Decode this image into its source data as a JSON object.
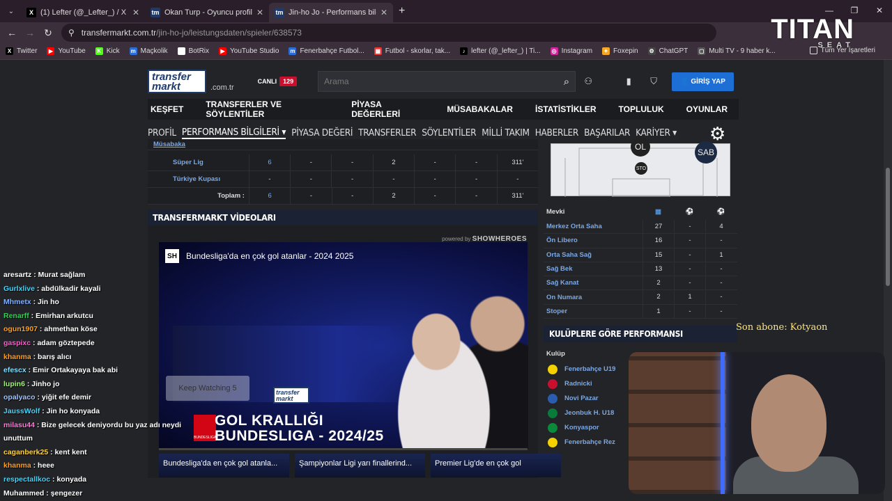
{
  "browser": {
    "tabs": [
      {
        "label": "(1) Lefter (@_Lefter_) / X",
        "icon": "X",
        "color": "#000"
      },
      {
        "label": "Okan Turp - Oyuncu profili | Tra",
        "icon": "tm",
        "color": "#1d3a6b"
      },
      {
        "label": "Jin-ho Jo - Performans bilgileri",
        "icon": "tm",
        "color": "#1d3a6b"
      }
    ],
    "url_host": "transfermarkt.com.tr",
    "url_path": "/jin-ho-jo/leistungsdaten/spieler/638573",
    "bookmarks": [
      {
        "label": "Twitter",
        "icon": "X",
        "color": "#000"
      },
      {
        "label": "YouTube",
        "icon": "▶",
        "color": "#f00"
      },
      {
        "label": "Kick",
        "icon": "K",
        "color": "#53fc18"
      },
      {
        "label": "Maçkolik",
        "icon": "m",
        "color": "#2b6cd6"
      },
      {
        "label": "BotRix",
        "icon": "◆",
        "color": "#fff"
      },
      {
        "label": "YouTube Studio",
        "icon": "▶",
        "color": "#f00"
      },
      {
        "label": "Fenerbahçe Futbol...",
        "icon": "m",
        "color": "#2b6cd6"
      },
      {
        "label": "Futbol - skorlar, tak...",
        "icon": "▦",
        "color": "#e33"
      },
      {
        "label": "lefter (@_lefter_) | Ti...",
        "icon": "♪",
        "color": "#000"
      },
      {
        "label": "Instagram",
        "icon": "◎",
        "color": "#d6249f"
      },
      {
        "label": "Foxepin",
        "icon": "✦",
        "color": "#f5a623"
      },
      {
        "label": "ChatGPT",
        "icon": "⚙",
        "color": "#444"
      },
      {
        "label": "Multi TV - 9 haber k...",
        "icon": "▢",
        "color": "#555"
      }
    ],
    "all_bookmarks": "Tüm Yer İşaretleri"
  },
  "overlay": {
    "brand": "TITAN",
    "brand_sub": "SEAT",
    "sub_alert": "Son abone: Kotyaon"
  },
  "site": {
    "logo_top": "transfer",
    "logo_bottom": "markt",
    "domain": ".com.tr",
    "live_label": "CANLI",
    "live_count": "129",
    "search_placeholder": "Arama",
    "login": "GİRİŞ YAP",
    "main_nav": [
      "KEŞFET",
      "TRANSFERLER VE SÖYLENTİLER",
      "PİYASA DEĞERLERİ",
      "MÜSABAKALAR",
      "İSTATİSTİKLER",
      "TOPLULUK",
      "OYUNLAR"
    ],
    "sub_nav": [
      "PROFİL",
      "PERFORMANS BİLGİLERİ ▾",
      "PİYASA DEĞERİ",
      "TRANSFERLER",
      "SÖYLENTİLER",
      "MİLLİ TAKIM",
      "HABERLER",
      "BAŞARILAR",
      "KARİYER ▾"
    ]
  },
  "stats": {
    "header": "Müsabaka",
    "rows": [
      {
        "name": "Süper Lig",
        "cells": [
          "6",
          "-",
          "-",
          "2",
          "-",
          "-",
          "311'"
        ]
      },
      {
        "name": "Türkiye Kupası",
        "cells": [
          "-",
          "-",
          "-",
          "-",
          "-",
          "-",
          "-"
        ]
      },
      {
        "name": "Toplam :",
        "cells": [
          "6",
          "-",
          "-",
          "2",
          "-",
          "-",
          "311'"
        ]
      }
    ]
  },
  "videos": {
    "title": "TRANSFERMARKT VİDEOLARI",
    "powered": "powered by",
    "powered_brand": "SHOWHEROES",
    "player_title": "Bundesliga'da en çok gol atanlar - 2024 2025",
    "banner_line1": "GOL KRALLIĞI",
    "banner_line2": "BUNDESLIGA - 2024/25",
    "banner_small": "BUNDESLIGA",
    "keep": "Keep Watching 5",
    "thumbs": [
      "Bundesliga'da en çok gol atanla...",
      "Şampiyonlar Ligi yarı finallerind...",
      "Premier Lig'de en çok gol"
    ]
  },
  "positions_pitch": [
    "OL",
    "SAB",
    "STO"
  ],
  "positions": {
    "header": "Mevki",
    "rows": [
      {
        "name": "Merkez Orta Saha",
        "v": [
          "27",
          "-",
          "4"
        ]
      },
      {
        "name": "Ön Libero",
        "v": [
          "16",
          "-",
          "-"
        ]
      },
      {
        "name": "Orta Saha Sağ",
        "v": [
          "15",
          "-",
          "1"
        ]
      },
      {
        "name": "Sağ Bek",
        "v": [
          "13",
          "-",
          "-"
        ]
      },
      {
        "name": "Sağ Kanat",
        "v": [
          "2",
          "-",
          "-"
        ]
      },
      {
        "name": "On Numara",
        "v": [
          "2",
          "1",
          "-"
        ]
      },
      {
        "name": "Stoper",
        "v": [
          "1",
          "-",
          "-"
        ]
      }
    ]
  },
  "clubs": {
    "title": "KULÜPLERE GÖRE PERFORMANSI",
    "header": "Kulüp",
    "rows": [
      {
        "name": "Fenerbahçe U19",
        "color": "#f5d100"
      },
      {
        "name": "Radnicki",
        "color": "#c8102e"
      },
      {
        "name": "Novi Pazar",
        "color": "#2a5db0"
      },
      {
        "name": "Jeonbuk H. U18",
        "color": "#0a7a3a"
      },
      {
        "name": "Konyaspor",
        "color": "#0a8a3a"
      },
      {
        "name": "Fenerbahçe Rez",
        "color": "#f5d100"
      }
    ]
  },
  "chat": [
    {
      "user": "aresartz",
      "color": "#fff",
      "msg": "Murat sağlam"
    },
    {
      "user": "Gurlxlive",
      "color": "#3dd6ff",
      "msg": "abdülkadir kayali"
    },
    {
      "user": "Mhmetx",
      "color": "#7fb0ff",
      "msg": "Jin ho"
    },
    {
      "user": "Renarff",
      "color": "#34d058",
      "msg": "Emirhan arkutcu"
    },
    {
      "user": "ogun1907",
      "color": "#ff9f1c",
      "msg": "ahmethan köse"
    },
    {
      "user": "gaspixc",
      "color": "#ff5bd1",
      "msg": "adam göztepede"
    },
    {
      "user": "khanma",
      "color": "#ff9f1c",
      "msg": "barış alıcı"
    },
    {
      "user": "efescx",
      "color": "#7fe0ff",
      "msg": "Emir Ortakayaya bak abi"
    },
    {
      "user": "lupin6",
      "color": "#a3f27a",
      "msg": "Jinho jo"
    },
    {
      "user": "opalyaco",
      "color": "#9ec4ff",
      "msg": "yiğit efe demir"
    },
    {
      "user": "JaussWolf",
      "color": "#3dd6ff",
      "msg": "Jin ho konyada"
    },
    {
      "user": "milasu44",
      "color": "#ff7ad9",
      "msg": "Bize gelecek deniyordu bu yaz adı neydi unuttum"
    },
    {
      "user": "caganberk25",
      "color": "#ffd23f",
      "msg": "kent kent"
    },
    {
      "user": "khanma",
      "color": "#ff9f1c",
      "msg": "heee"
    },
    {
      "user": "respectallkoc",
      "color": "#3dd6ff",
      "msg": "konyada"
    },
    {
      "user": "Muhammed",
      "color": "#fff",
      "msg": "şengezer"
    }
  ]
}
